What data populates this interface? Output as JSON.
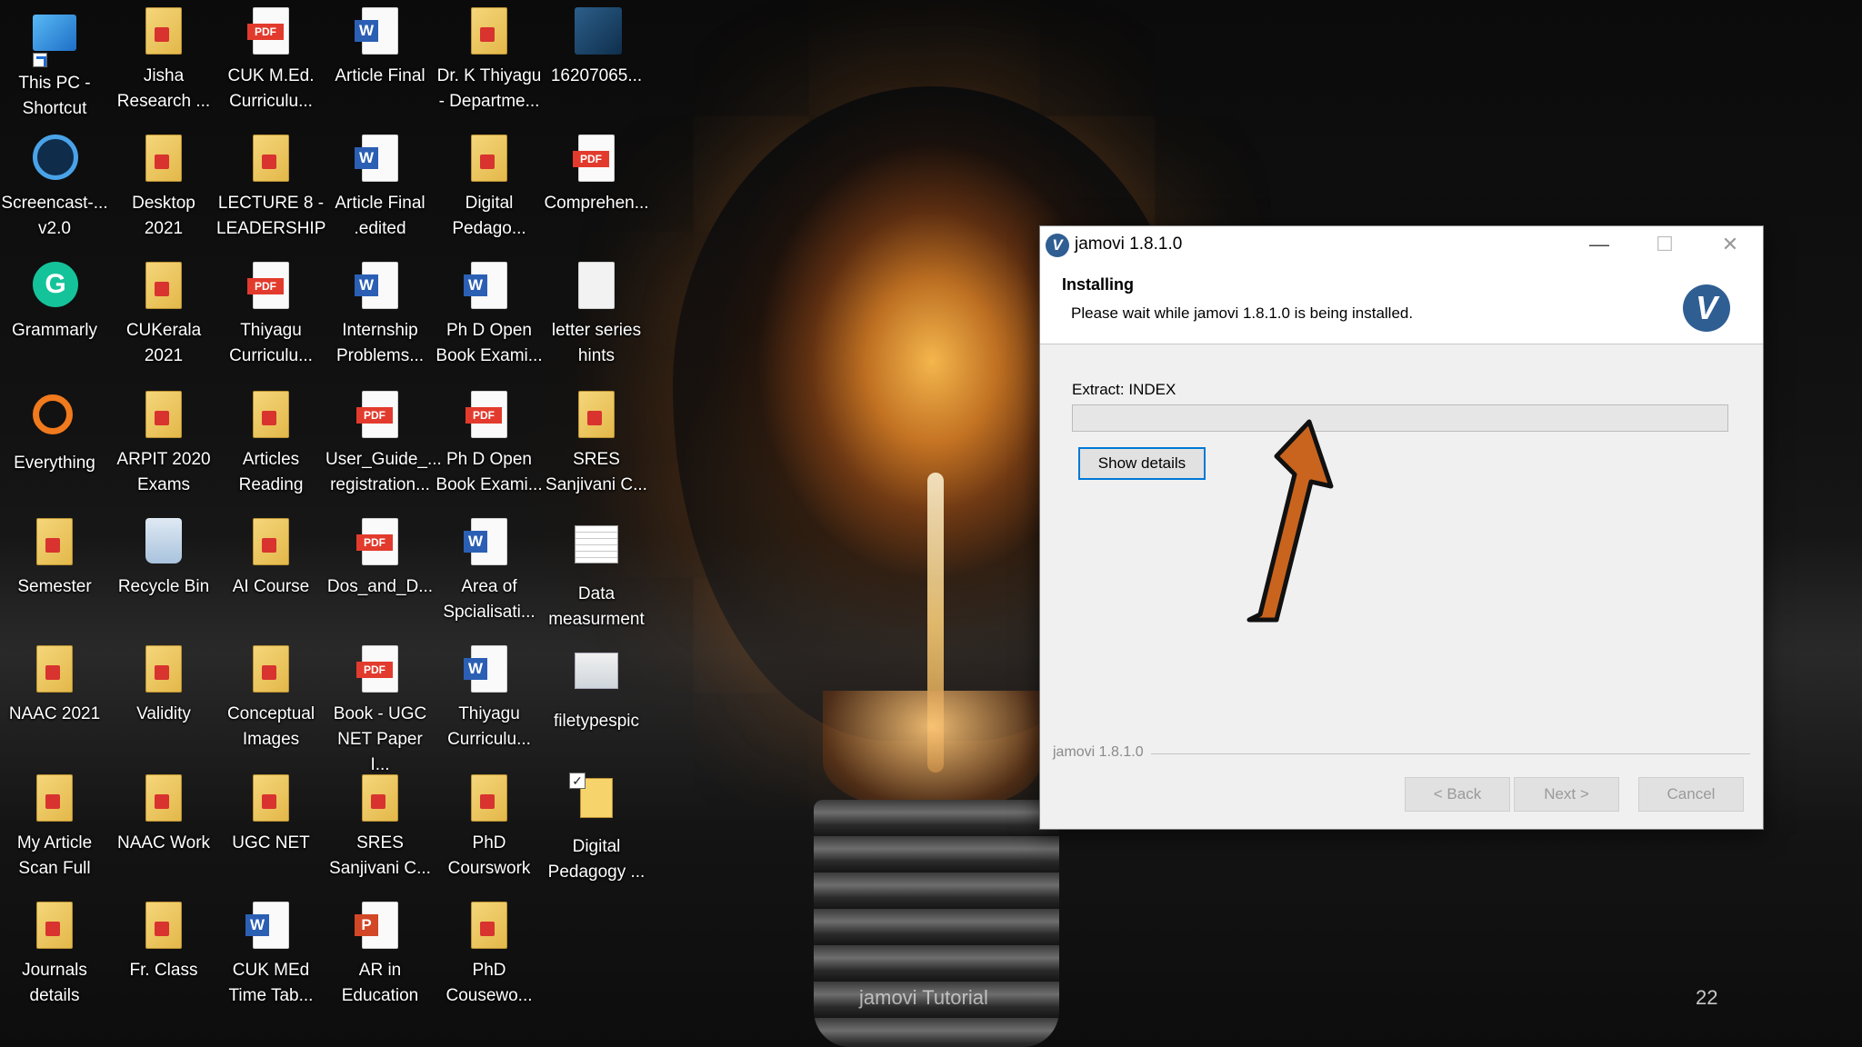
{
  "desktop": {
    "icons": [
      {
        "label": "This PC -\nShortcut",
        "icon": "this-pc-icon"
      },
      {
        "label": "Jisha\nResearch ...",
        "icon": "folder-icon"
      },
      {
        "label": "CUK M.Ed.\nCurriculu...",
        "icon": "pdf-icon"
      },
      {
        "label": "Article Final",
        "icon": "word-icon"
      },
      {
        "label": "Dr. K Thiyagu\n- Departme...",
        "icon": "folder-icon"
      },
      {
        "label": "16207065...",
        "icon": "download-icon"
      },
      {
        "label": "Screencast-...\nv2.0",
        "icon": "screencast-icon"
      },
      {
        "label": "Desktop\n2021",
        "icon": "folder-icon"
      },
      {
        "label": "LECTURE 8 -\nLEADERSHIP",
        "icon": "folder-icon"
      },
      {
        "label": "Article Final\n.edited",
        "icon": "word-icon"
      },
      {
        "label": "Digital\nPedago...",
        "icon": "folder-icon"
      },
      {
        "label": "Comprehen...",
        "icon": "pdf-icon"
      },
      {
        "label": "Grammarly",
        "icon": "grammarly-icon"
      },
      {
        "label": "CUKerala\n2021",
        "icon": "folder-icon"
      },
      {
        "label": "Thiyagu\nCurriculu...",
        "icon": "pdf-icon"
      },
      {
        "label": "Internship\nProblems...",
        "icon": "word-icon"
      },
      {
        "label": "Ph D Open\nBook Exami...",
        "icon": "word-icon"
      },
      {
        "label": "letter series\nhints",
        "icon": "document-icon"
      },
      {
        "label": "Everything",
        "icon": "everything-icon"
      },
      {
        "label": "ARPIT 2020\nExams",
        "icon": "folder-icon"
      },
      {
        "label": "Articles\nReading",
        "icon": "folder-icon"
      },
      {
        "label": "User_Guide_...\nregistration...",
        "icon": "pdf-icon"
      },
      {
        "label": "Ph D Open\nBook Exami...",
        "icon": "pdf-icon"
      },
      {
        "label": "SRES\nSanjivani C...",
        "icon": "folder-icon"
      },
      {
        "label": "Semester",
        "icon": "folder-icon"
      },
      {
        "label": "Recycle Bin",
        "icon": "recycle-bin-icon"
      },
      {
        "label": "AI Course",
        "icon": "folder-icon"
      },
      {
        "label": "Dos_and_D...",
        "icon": "pdf-icon"
      },
      {
        "label": "Area of\nSpcialisati...",
        "icon": "word-icon"
      },
      {
        "label": "Data\nmeasurment",
        "icon": "spreadsheet-icon"
      },
      {
        "label": "NAAC 2021",
        "icon": "folder-icon"
      },
      {
        "label": "Validity",
        "icon": "folder-icon"
      },
      {
        "label": "Conceptual\nImages",
        "icon": "folder-icon"
      },
      {
        "label": "Book - UGC\nNET Paper I...",
        "icon": "pdf-icon"
      },
      {
        "label": "Thiyagu\nCurriculu...",
        "icon": "word-icon"
      },
      {
        "label": "filetypespic",
        "icon": "image-icon"
      },
      {
        "label": "My Article\nScan Full",
        "icon": "folder-icon"
      },
      {
        "label": "NAAC Work",
        "icon": "folder-icon"
      },
      {
        "label": "UGC NET",
        "icon": "folder-icon"
      },
      {
        "label": "SRES\nSanjivani C...",
        "icon": "folder-icon"
      },
      {
        "label": "PhD\nCourswork",
        "icon": "folder-icon"
      },
      {
        "label": "Digital\nPedagogy ...",
        "icon": "checked-folder-icon"
      },
      {
        "label": "Journals\ndetails",
        "icon": "folder-icon"
      },
      {
        "label": "Fr. Class",
        "icon": "folder-icon"
      },
      {
        "label": "CUK MEd\nTime Tab...",
        "icon": "word-icon"
      },
      {
        "label": "AR in\nEducation",
        "icon": "powerpoint-icon"
      },
      {
        "label": "PhD\nCousewo...",
        "icon": "folder-icon"
      }
    ]
  },
  "installer": {
    "title": "jamovi 1.8.1.0",
    "minimize": "—",
    "maximize": "☐",
    "close": "✕",
    "heading": "Installing",
    "subheading": "Please wait while jamovi 1.8.1.0 is being installed.",
    "extract_label": "Extract: INDEX",
    "progress": 0,
    "show_details": "Show details",
    "brand_footer": "jamovi 1.8.1.0",
    "back": "< Back",
    "next": "Next >",
    "cancel": "Cancel",
    "logo_letter": "V"
  },
  "overlay": {
    "watermark": "jamovi Tutorial",
    "page_number": "22"
  },
  "colors": {
    "arrow_fill": "#c9641e",
    "focus_border": "#0078d7",
    "jamovi_blue": "#2f5e93"
  }
}
